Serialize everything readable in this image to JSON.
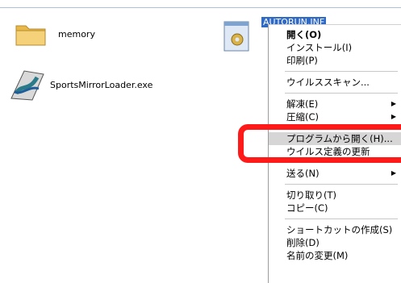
{
  "files": {
    "folder": {
      "name": "memory"
    },
    "exe": {
      "name": "SportsMirrorLoader.exe"
    },
    "inf": {
      "name": "AUTORUN.INF"
    }
  },
  "menu": {
    "open": "開く(O)",
    "install": "インストール(I)",
    "print": "印刷(P)",
    "virus_scan": "ウイルススキャン...",
    "extract": "解凍(E)",
    "compress": "圧縮(C)",
    "open_with": "プログラムから開く(H)...",
    "virus_definitions": "ウイルス定義の更新",
    "send_to": "送る(N)",
    "cut": "切り取り(T)",
    "copy": "コピー(C)",
    "create_shortcut": "ショートカットの作成(S)",
    "delete": "削除(D)",
    "rename": "名前の変更(M)"
  },
  "colors": {
    "highlight": "#ff1a1a",
    "selection": "#316ac5"
  }
}
